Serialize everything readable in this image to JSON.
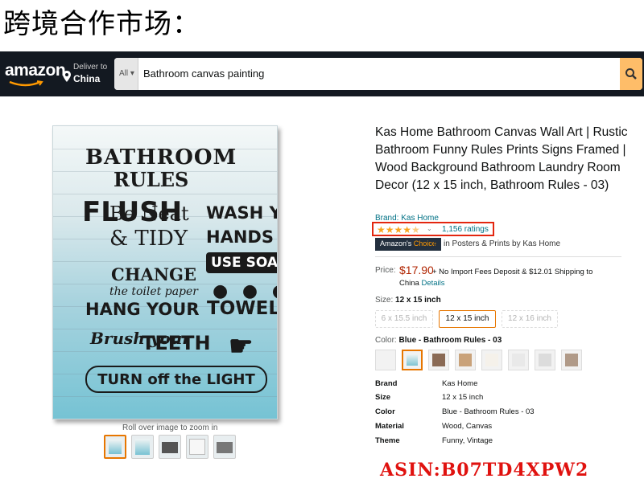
{
  "caption": "跨境合作市场：",
  "navbar": {
    "logo": "amazon",
    "deliver_line1": "Deliver to",
    "deliver_line2": "China",
    "dept": "All",
    "search_query": "Bathroom canvas painting",
    "search_icon": "search-icon"
  },
  "product_image": {
    "lines": [
      "BATHROOM",
      "RULES",
      "FLUSH",
      "Be Neat",
      "WASH YOUR",
      "& TIDY",
      "HANDS",
      "USE SOAP",
      "CHANGE",
      "the toilet paper",
      "● ● ● ●",
      "HANG YOUR",
      "TOWEL",
      "Brush your",
      "TEETH",
      "☛",
      "TURN off the LIGHT"
    ],
    "zoom_hint": "Roll over image to zoom in"
  },
  "thumbnails": [
    {
      "selected": true
    },
    {
      "selected": false
    },
    {
      "selected": false
    },
    {
      "selected": false
    },
    {
      "selected": false
    }
  ],
  "details": {
    "title": "Kas Home Bathroom Canvas Wall Art | Rustic Bathroom Funny Rules Prints Signs Framed | Wood Background Bathroom Laundry Room Decor (12 x 15 inch, Bathroom Rules - 03)",
    "brand_link": "Brand: Kas Home",
    "stars": "★★★★",
    "half_star": "★",
    "caret": "⌄",
    "rating_value": 4.5,
    "ratings_count": "1,156 ratings",
    "choice_1": "Amazon's",
    "choice_2": "Choice",
    "choice_category": "in Posters & Prints by Kas Home",
    "price_label": "Price:",
    "price": "$17.90",
    "shipping_line1": "+ No Import Fees Deposit & $12.01 Shipping to",
    "shipping_line2": "China",
    "shipping_link": "Details",
    "size_label": "Size:",
    "size_value": "12 x 15 inch",
    "sizes": [
      "6 x 15.5 inch",
      "12 x 15 inch",
      "12 x 16 inch"
    ],
    "color_label": "Color:",
    "color_value": "Blue - Bathroom Rules - 03",
    "swatch_colors": [
      "#f2f2f2",
      "#7fc4d3",
      "#8a6a55",
      "#c9a27a",
      "#f5f1ea",
      "#e9e9e9",
      "#dcdcdc",
      "#b09a88"
    ],
    "specs": [
      {
        "key": "Brand",
        "value": "Kas Home"
      },
      {
        "key": "Size",
        "value": "12 x 15 inch"
      },
      {
        "key": "Color",
        "value": "Blue - Bathroom Rules - 03"
      },
      {
        "key": "Material",
        "value": "Wood, Canvas"
      },
      {
        "key": "Theme",
        "value": "Funny, Vintage"
      }
    ]
  },
  "asin": "ASIN:B07TD4XPW2",
  "colors": {
    "nav_bg": "#131921",
    "search_button": "#febd69",
    "link": "#007185",
    "price": "#b12704",
    "highlight_red": "#e3260f",
    "selected_orange": "#e77600"
  }
}
